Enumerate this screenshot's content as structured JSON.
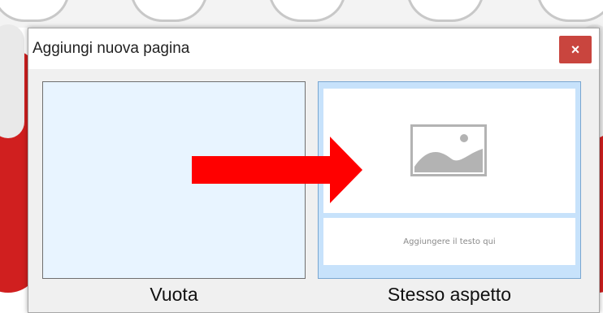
{
  "dialog": {
    "title": "Aggiungi nuova pagina",
    "close_label": "×"
  },
  "options": [
    {
      "id": "blank",
      "label": "Vuota"
    },
    {
      "id": "same",
      "label": "Stesso aspetto",
      "placeholder_text": "Aggiungere il testo qui"
    }
  ],
  "colors": {
    "close_button": "#c9453e",
    "arrow": "#ff0000",
    "blank_fill": "#e8f4ff",
    "selected_fill": "#c7e2fb"
  }
}
